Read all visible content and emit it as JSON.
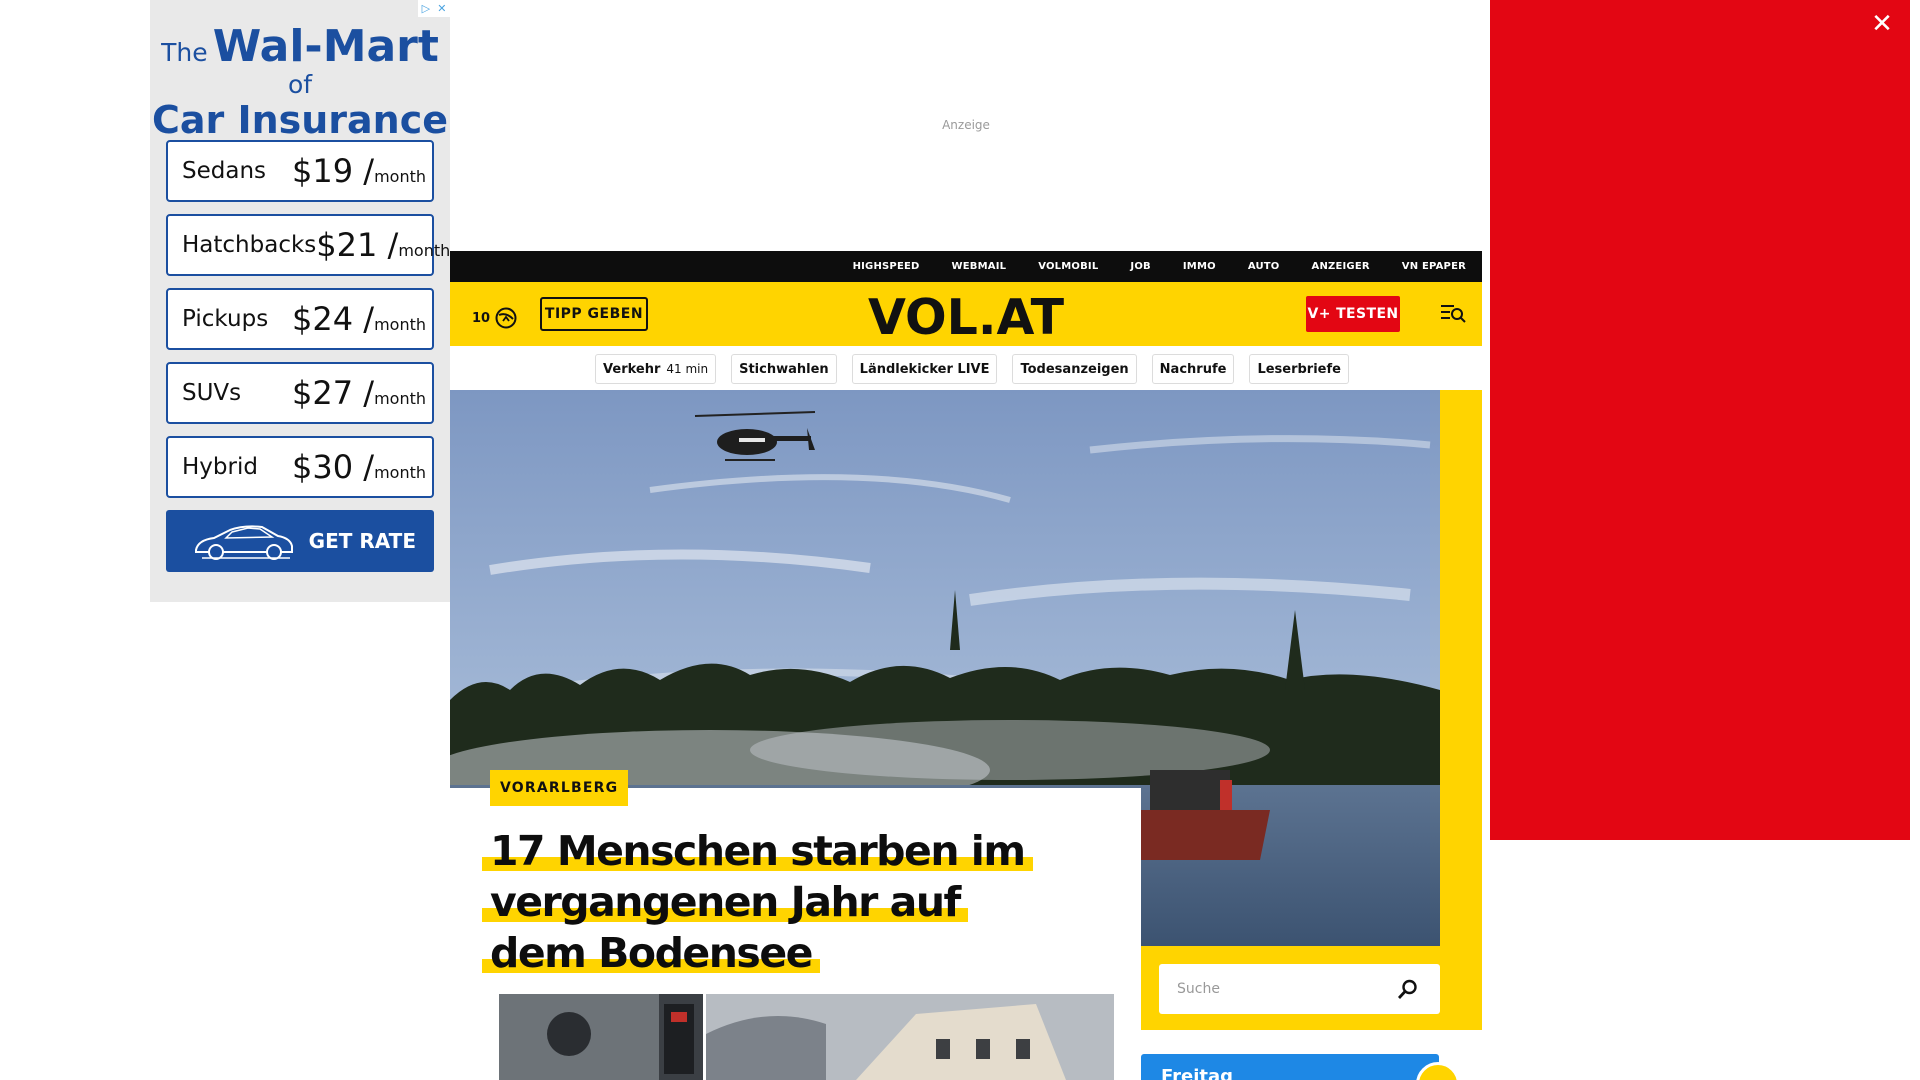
{
  "left_ad": {
    "adchoices_icons": [
      "adchoices-icon",
      "close-icon"
    ],
    "headline": {
      "the": "The",
      "brand": "Wal-Mart",
      "of": "of",
      "line2": "Car Insurance"
    },
    "rows": [
      {
        "name": "Sedans",
        "price": "$19 /",
        "per": "month"
      },
      {
        "name": "Hatchbacks",
        "price": "$21 /",
        "per": "month"
      },
      {
        "name": "Pickups",
        "price": "$24 /",
        "per": "month"
      },
      {
        "name": "SUVs",
        "price": "$27 /",
        "per": "month"
      },
      {
        "name": "Hybrid",
        "price": "$30 /",
        "per": "month"
      }
    ],
    "cta": "GET RATE",
    "colors": {
      "brand": "#1b4fa0",
      "background": "#e9e9e9"
    }
  },
  "top_ad": {
    "label": "Anzeige"
  },
  "topbar": {
    "links": [
      "HIGHSPEED",
      "WEBMAIL",
      "VOLMOBIL",
      "JOB",
      "IMMO",
      "AUTO",
      "ANZEIGER",
      "VN EPAPER"
    ]
  },
  "header": {
    "weather_count": "10",
    "tipp_label": "TIPP GEBEN",
    "logo": "VOL.AT",
    "vplus_label": "V+ TESTEN",
    "menu_icon": "menu-search-icon",
    "colors": {
      "yellow": "#ffd400",
      "red": "#e30613"
    }
  },
  "pills": [
    {
      "label": "Verkehr",
      "sub": "41 min"
    },
    {
      "label": "Stichwahlen",
      "sub": ""
    },
    {
      "label": "Ländlekicker LIVE",
      "sub": ""
    },
    {
      "label": "Todesanzeigen",
      "sub": ""
    },
    {
      "label": "Nachrufe",
      "sub": ""
    },
    {
      "label": "Leserbriefe",
      "sub": ""
    }
  ],
  "article": {
    "category": "VORARLBERG",
    "title": "17 Menschen starben im vergangenen Jahr auf dem Bodensee"
  },
  "search": {
    "placeholder": "Suche"
  },
  "weather": {
    "day": "Freitag"
  },
  "right_ad": {
    "color": "#e30613",
    "close_icon": "close-icon"
  }
}
